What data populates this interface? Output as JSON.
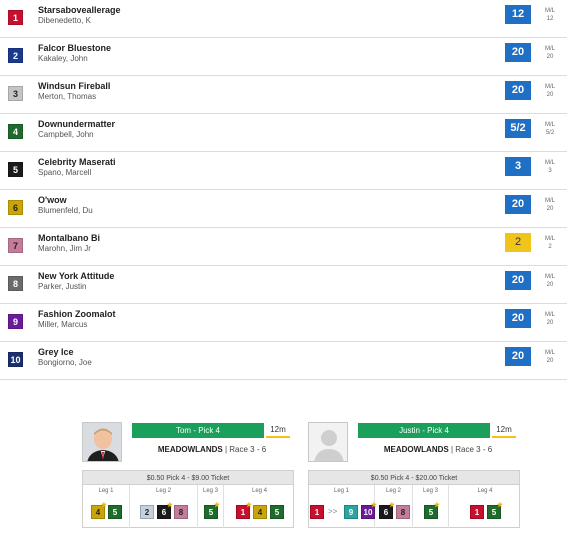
{
  "runners": [
    {
      "pp": "1",
      "name": "Starsaboveallerage",
      "jockey": "Dibenedetto, K",
      "odds": "12",
      "ml_label": "M/L",
      "ml": "12",
      "bg": "#c8102e",
      "fg": "#ffffff"
    },
    {
      "pp": "2",
      "name": "Falcor Bluestone",
      "jockey": "Kakaley, John",
      "odds": "20",
      "ml_label": "M/L",
      "ml": "20",
      "bg": "#1a3a8f",
      "fg": "#ffffff"
    },
    {
      "pp": "3",
      "name": "Windsun Fireball",
      "jockey": "Merton, Thomas",
      "odds": "20",
      "ml_label": "M/L",
      "ml": "20",
      "bg": "#c4c4c4",
      "fg": "#222222"
    },
    {
      "pp": "4",
      "name": "Downundermatter",
      "jockey": "Campbell, John",
      "odds": "5/2",
      "ml_label": "M/L",
      "ml": "5/2",
      "bg": "#1e6b2c",
      "fg": "#ffffff"
    },
    {
      "pp": "5",
      "name": "Celebrity Maserati",
      "jockey": "Spano, Marcell",
      "odds": "3",
      "ml_label": "M/L",
      "ml": "3",
      "bg": "#1a1a1a",
      "fg": "#ffffff"
    },
    {
      "pp": "6",
      "name": "O'wow",
      "jockey": "Blumenfeld, Du",
      "odds": "20",
      "ml_label": "M/L",
      "ml": "20",
      "bg": "#c9a50a",
      "fg": "#222222"
    },
    {
      "pp": "7",
      "name": "Montalbano Bi",
      "jockey": "Marohn, Jim Jr",
      "odds": "2",
      "ml_label": "M/L",
      "ml": "2",
      "bg": "#c47c9a",
      "fg": "#222222",
      "favorite": true
    },
    {
      "pp": "8",
      "name": "New York Attitude",
      "jockey": "Parker, Justin",
      "odds": "20",
      "ml_label": "M/L",
      "ml": "20",
      "bg": "#6b6b6b",
      "fg": "#ffffff"
    },
    {
      "pp": "9",
      "name": "Fashion Zoomalot",
      "jockey": "Miller, Marcus",
      "odds": "20",
      "ml_label": "M/L",
      "ml": "20",
      "bg": "#6a1b9a",
      "fg": "#ffffff"
    },
    {
      "pp": "10",
      "name": "Grey Ice",
      "jockey": "Bongiorno, Joe",
      "odds": "20",
      "ml_label": "M/L",
      "ml": "20",
      "bg": "#1a2f6e",
      "fg": "#ffffff"
    }
  ],
  "colors": {
    "odds_blue": "#1f6fc4",
    "favorite_yellow": "#f0c419",
    "pick_green": "#1aa05a"
  },
  "picks": [
    {
      "id": "tom",
      "title": "Tom - Pick 4",
      "timer": "12m",
      "track": "MEADOWLANDS",
      "race": " | Race 3 - 6",
      "ticket": "$0.50 Pick 4 - $9.00 Ticket",
      "legs": [
        {
          "label": "Leg 1",
          "selections": [
            {
              "n": "4",
              "star": true
            },
            {
              "n": "5"
            }
          ]
        },
        {
          "label": "Leg 2",
          "selections": [
            {
              "n": "2"
            },
            {
              "n": "6",
              "star": true
            },
            {
              "n": "8"
            }
          ]
        },
        {
          "label": "Leg 3",
          "selections": [
            {
              "n": "5",
              "star": true
            }
          ]
        },
        {
          "label": "Leg 4",
          "selections": [
            {
              "n": "1",
              "star": true
            },
            {
              "n": "4"
            },
            {
              "n": "5"
            }
          ]
        }
      ]
    },
    {
      "id": "justin",
      "title": "Justin - Pick 4",
      "timer": "12m",
      "track": "MEADOWLANDS",
      "race": " | Race 3 - 6",
      "ticket": "$0.50 Pick 4 - $20.00 Ticket",
      "legs": [
        {
          "label": "Leg 1",
          "selections": [
            {
              "n": "1"
            },
            {
              "n": ">>"
            },
            {
              "n": "9"
            },
            {
              "n": "10",
              "star": true
            }
          ]
        },
        {
          "label": "Leg 2",
          "selections": [
            {
              "n": "6",
              "star": true
            },
            {
              "n": "8"
            }
          ]
        },
        {
          "label": "Leg 3",
          "selections": [
            {
              "n": "5",
              "star": true
            }
          ]
        },
        {
          "label": "Leg 4",
          "selections": [
            {
              "n": "1"
            },
            {
              "n": "5",
              "star": true
            }
          ]
        }
      ]
    }
  ],
  "saddlecloth_colors": {
    "1": {
      "bg": "#c8102e",
      "fg": "#ffffff"
    },
    "2": {
      "bg": "#c4d0dc",
      "fg": "#222222"
    },
    "4": {
      "bg": "#c9a50a",
      "fg": "#222222"
    },
    "5": {
      "bg": "#1e6b2c",
      "fg": "#ffffff"
    },
    "6": {
      "bg": "#1a1a1a",
      "fg": "#ffffff"
    },
    "8": {
      "bg": "#c47c9a",
      "fg": "#222222"
    },
    "9": {
      "bg": "#2aa5a0",
      "fg": "#ffffff"
    },
    "10": {
      "bg": "#6a1b9a",
      "fg": "#ffffff"
    }
  }
}
